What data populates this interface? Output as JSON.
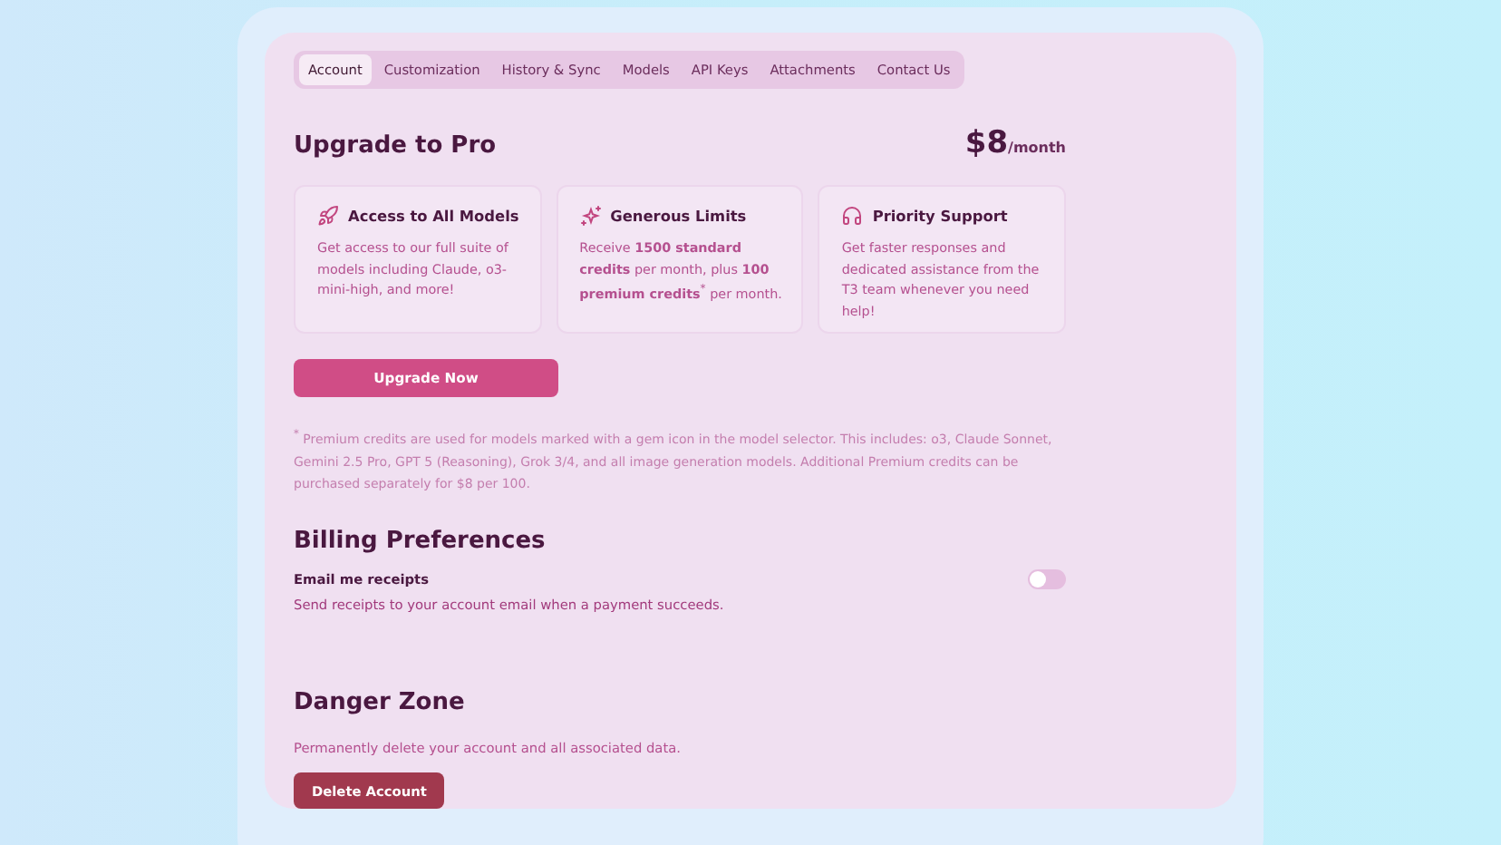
{
  "tabs": [
    {
      "label": "Account",
      "selected": true
    },
    {
      "label": "Customization",
      "selected": false
    },
    {
      "label": "History & Sync",
      "selected": false
    },
    {
      "label": "Models",
      "selected": false
    },
    {
      "label": "API Keys",
      "selected": false
    },
    {
      "label": "Attachments",
      "selected": false
    },
    {
      "label": "Contact Us",
      "selected": false
    }
  ],
  "upgrade": {
    "title": "Upgrade to Pro",
    "price": "$8",
    "period": "/month",
    "features": [
      {
        "kind": "rocket",
        "title": "Access to All Models",
        "text": "Get access to our full suite of models including Claude, o3-mini-high, and more!"
      },
      {
        "kind": "sparkle",
        "title": "Generous Limits",
        "text": "Receive **1500 standard credits** per month, plus **100 premium credits**$^{*}$ per month."
      },
      {
        "kind": "headset",
        "title": "Priority Support",
        "text": "Get faster responses and dedicated assistance from the T3 team whenever you need help!"
      }
    ],
    "button": "Upgrade Now",
    "footnote": "$^{*}$ Premium credits are used for models marked with a gem icon in the model selector. This includes: o3, Claude Sonnet, Gemini 2.5 Pro, GPT 5 (Reasoning), Grok 3/4, and all image generation models. Additional Premium credits can be purchased separately for $8 per 100."
  },
  "billing": {
    "title": "Billing Preferences",
    "setting": {
      "label": "Email me receipts",
      "description": "Send receipts to your account email when a payment succeeds.",
      "on": false
    }
  },
  "danger": {
    "title": "Danger Zone",
    "text": "Permanently delete your account and all associated data.",
    "button": "Delete Account"
  }
}
